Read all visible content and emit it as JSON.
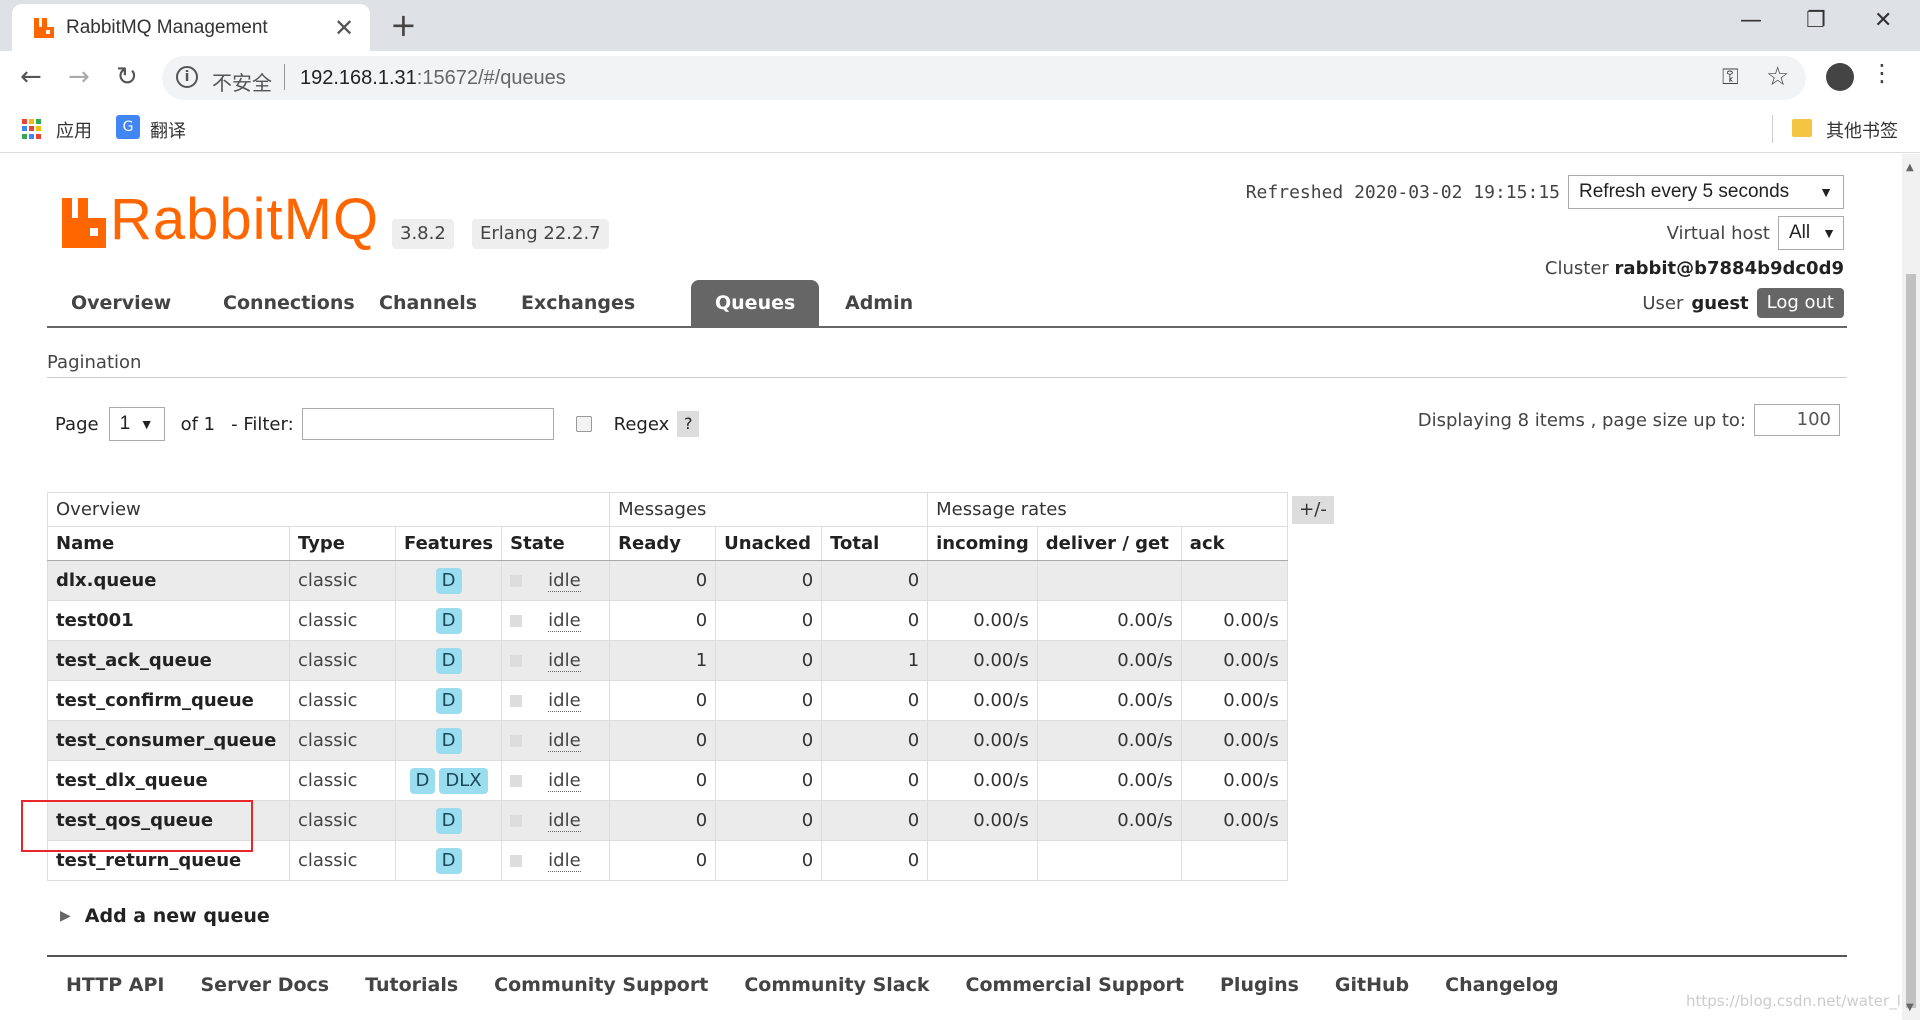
{
  "browser": {
    "tab_title": "RabbitMQ Management",
    "tab_close": "✕",
    "new_tab": "+",
    "insecure_label": "不安全",
    "url_host": "192.168.1.31",
    "url_rest": ":15672/#/queues",
    "bookmarks": {
      "apps": "应用",
      "translate": "翻译",
      "other": "其他书签"
    }
  },
  "header": {
    "logo_text": "RabbitMQ",
    "version": "3.8.2",
    "erlang": "Erlang 22.2.7",
    "refreshed": "Refreshed 2020-03-02 19:15:15",
    "refresh_select": "Refresh every 5 seconds",
    "virtual_host_label": "Virtual host",
    "virtual_host_value": "All",
    "cluster_label": "Cluster",
    "cluster_value": "rabbit@b7884b9dc0d9",
    "user_label": "User",
    "user_value": "guest",
    "logout": "Log out"
  },
  "nav": {
    "items": [
      "Overview",
      "Connections",
      "Channels",
      "Exchanges",
      "Queues",
      "Admin"
    ],
    "active": "Queues"
  },
  "pagination": {
    "title": "Pagination",
    "page_label": "Page",
    "page_value": "1",
    "of_label": "of 1",
    "filter_label": "- Filter:",
    "filter_value": "",
    "regex_label": "Regex",
    "help": "?",
    "displaying": "Displaying 8 items , page size up to:",
    "page_size": "100"
  },
  "table": {
    "groups": [
      "Overview",
      "Messages",
      "Message rates"
    ],
    "columns": [
      "Name",
      "Type",
      "Features",
      "State",
      "Ready",
      "Unacked",
      "Total",
      "incoming",
      "deliver / get",
      "ack"
    ],
    "toggle": "+/-",
    "rows": [
      {
        "name": "dlx.queue",
        "type": "classic",
        "features": [
          "D"
        ],
        "state": "idle",
        "ready": "0",
        "unacked": "0",
        "total": "0",
        "incoming": "",
        "deliver": "",
        "ack": ""
      },
      {
        "name": "test001",
        "type": "classic",
        "features": [
          "D"
        ],
        "state": "idle",
        "ready": "0",
        "unacked": "0",
        "total": "0",
        "incoming": "0.00/s",
        "deliver": "0.00/s",
        "ack": "0.00/s"
      },
      {
        "name": "test_ack_queue",
        "type": "classic",
        "features": [
          "D"
        ],
        "state": "idle",
        "ready": "1",
        "unacked": "0",
        "total": "1",
        "incoming": "0.00/s",
        "deliver": "0.00/s",
        "ack": "0.00/s"
      },
      {
        "name": "test_confirm_queue",
        "type": "classic",
        "features": [
          "D"
        ],
        "state": "idle",
        "ready": "0",
        "unacked": "0",
        "total": "0",
        "incoming": "0.00/s",
        "deliver": "0.00/s",
        "ack": "0.00/s"
      },
      {
        "name": "test_consumer_queue",
        "type": "classic",
        "features": [
          "D"
        ],
        "state": "idle",
        "ready": "0",
        "unacked": "0",
        "total": "0",
        "incoming": "0.00/s",
        "deliver": "0.00/s",
        "ack": "0.00/s"
      },
      {
        "name": "test_dlx_queue",
        "type": "classic",
        "features": [
          "D",
          "DLX"
        ],
        "state": "idle",
        "ready": "0",
        "unacked": "0",
        "total": "0",
        "incoming": "0.00/s",
        "deliver": "0.00/s",
        "ack": "0.00/s"
      },
      {
        "name": "test_qos_queue",
        "type": "classic",
        "features": [
          "D"
        ],
        "state": "idle",
        "ready": "0",
        "unacked": "0",
        "total": "0",
        "incoming": "0.00/s",
        "deliver": "0.00/s",
        "ack": "0.00/s"
      },
      {
        "name": "test_return_queue",
        "type": "classic",
        "features": [
          "D"
        ],
        "state": "idle",
        "ready": "0",
        "unacked": "0",
        "total": "0",
        "incoming": "",
        "deliver": "",
        "ack": ""
      }
    ]
  },
  "add_queue": "Add a new queue",
  "footer": [
    "HTTP API",
    "Server Docs",
    "Tutorials",
    "Community Support",
    "Community Slack",
    "Commercial Support",
    "Plugins",
    "GitHub",
    "Changelog"
  ],
  "watermark": "https://blog.csdn.net/water_lay",
  "colors": {
    "brand": "#ff6600",
    "nav_active": "#666666",
    "badge": "#99ddee",
    "highlight": "#e8262b"
  }
}
